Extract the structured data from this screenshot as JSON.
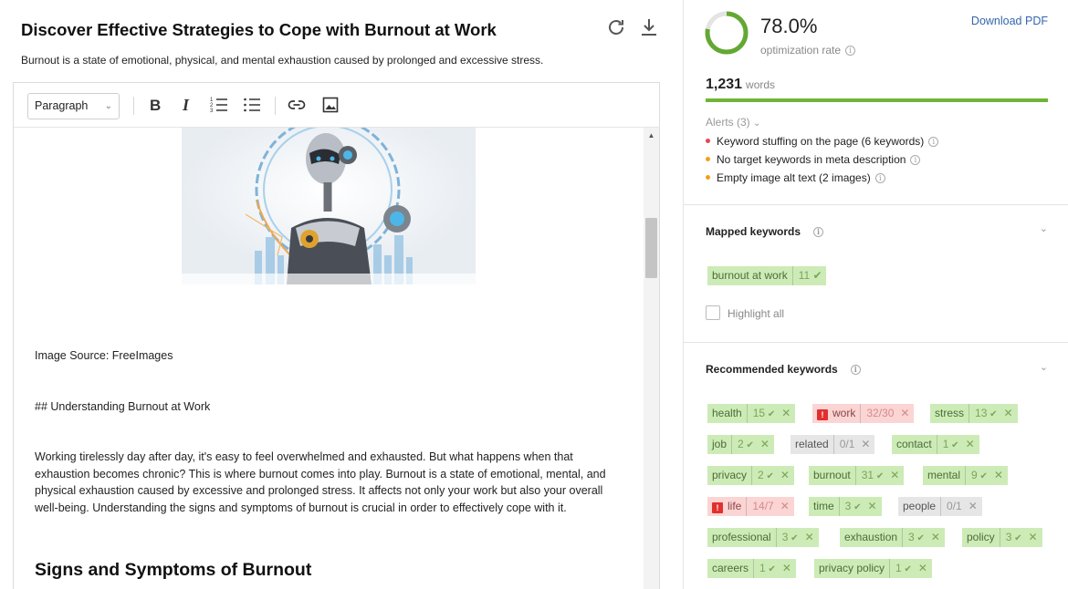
{
  "document": {
    "title": "Discover Effective Strategies to Cope with Burnout at Work",
    "description": "Burnout is a state of emotional, physical, and mental exhaustion caused by prolonged and excessive stress."
  },
  "toolbar": {
    "format_select": "Paragraph"
  },
  "content": {
    "image_source": "Image Source: FreeImages",
    "heading_md": "## Understanding Burnout at Work",
    "paragraph": "Working tirelessly day after day, it's easy to feel overwhelmed and exhausted. But what happens when that exhaustion becomes chronic? This is where burnout comes into play. Burnout is a state of emotional, mental, and physical exhaustion caused by excessive and prolonged stress. It affects not only your work but also your overall well-being. Understanding the signs and symptoms of burnout is crucial in order to effectively cope with it.",
    "heading2": "Signs and Symptoms of Burnout"
  },
  "score": {
    "rate": "78.0%",
    "rate_value": 0.78,
    "label": "optimization rate",
    "download": "Download PDF",
    "word_count": "1,231",
    "word_label": "words"
  },
  "alerts": {
    "label": "Alerts (3)",
    "items": [
      {
        "text": "Keyword stuffing on the page (6 keywords)",
        "color": "#e5484d"
      },
      {
        "text": "No target keywords in meta description",
        "color": "#f0a020"
      },
      {
        "text": "Empty image alt text (2 images)",
        "color": "#f0a020"
      }
    ]
  },
  "mapped": {
    "title": "Mapped keywords",
    "keyword": {
      "name": "burnout at work",
      "count": "11"
    },
    "highlight_label": "Highlight all"
  },
  "recommended": {
    "title": "Recommended keywords",
    "keywords": [
      {
        "name": "health",
        "count": "15",
        "status": "ok"
      },
      {
        "name": "work",
        "count": "32/30",
        "status": "over"
      },
      {
        "name": "stress",
        "count": "13",
        "status": "ok"
      },
      {
        "name": "job",
        "count": "2",
        "status": "ok"
      },
      {
        "name": "related",
        "count": "0/1",
        "status": "none"
      },
      {
        "name": "contact",
        "count": "1",
        "status": "ok"
      },
      {
        "name": "privacy",
        "count": "2",
        "status": "ok"
      },
      {
        "name": "burnout",
        "count": "31",
        "status": "ok"
      },
      {
        "name": "mental",
        "count": "9",
        "status": "ok"
      },
      {
        "name": "life",
        "count": "14/7",
        "status": "over"
      },
      {
        "name": "time",
        "count": "3",
        "status": "ok"
      },
      {
        "name": "people",
        "count": "0/1",
        "status": "none"
      },
      {
        "name": "professional",
        "count": "3",
        "status": "ok"
      },
      {
        "name": "exhaustion",
        "count": "3",
        "status": "ok"
      },
      {
        "name": "policy",
        "count": "3",
        "status": "ok"
      },
      {
        "name": "careers",
        "count": "1",
        "status": "ok"
      },
      {
        "name": "privacy policy",
        "count": "1",
        "status": "ok"
      }
    ]
  }
}
